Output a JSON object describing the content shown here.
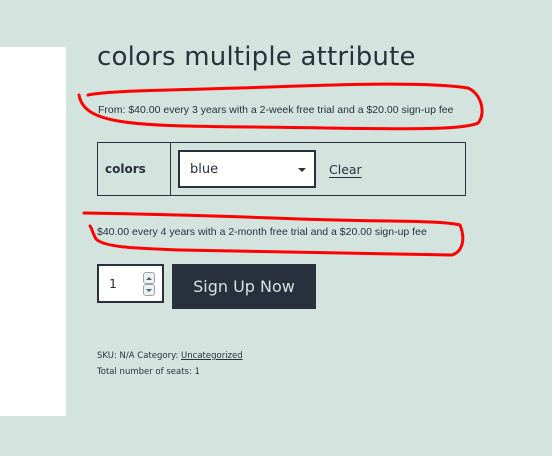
{
  "product": {
    "title": "colors multiple attribute",
    "price_from": "From: $40.00 every 3 years with a 2-week free trial and a $20.00 sign-up fee"
  },
  "variations": {
    "attribute_label": "colors",
    "selected_value": "blue",
    "clear_label": "Clear"
  },
  "variation_price": "$40.00 every 4 years with a 2-month free trial and a $20.00 sign-up fee",
  "cart": {
    "quantity": "1",
    "button_label": "Sign Up Now"
  },
  "meta": {
    "sku_text": "SKU: N/A Category: ",
    "category_link": "Uncategorized",
    "seats_text": "Total number of seats: 1"
  },
  "colors": {
    "background": "#d3e4de",
    "text": "#28303d",
    "annotation": "#ff0000"
  }
}
